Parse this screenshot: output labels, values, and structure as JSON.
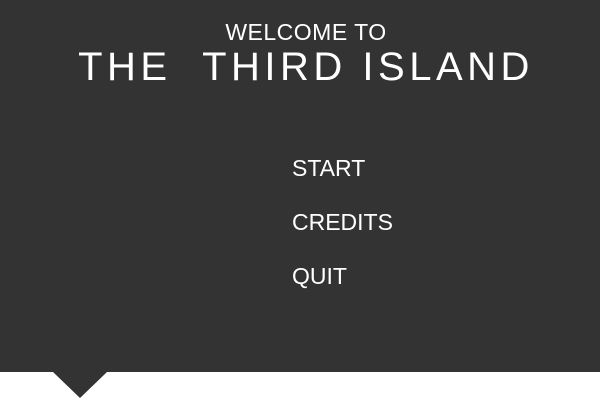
{
  "header": {
    "welcome": "WELCOME TO",
    "title": "THE  THIRD ISLAND"
  },
  "menu": {
    "items": [
      {
        "label": "START"
      },
      {
        "label": "CREDITS"
      },
      {
        "label": "QUIT"
      }
    ]
  },
  "colors": {
    "panel": "#333333",
    "text": "#ffffff",
    "background": "#ffffff"
  }
}
